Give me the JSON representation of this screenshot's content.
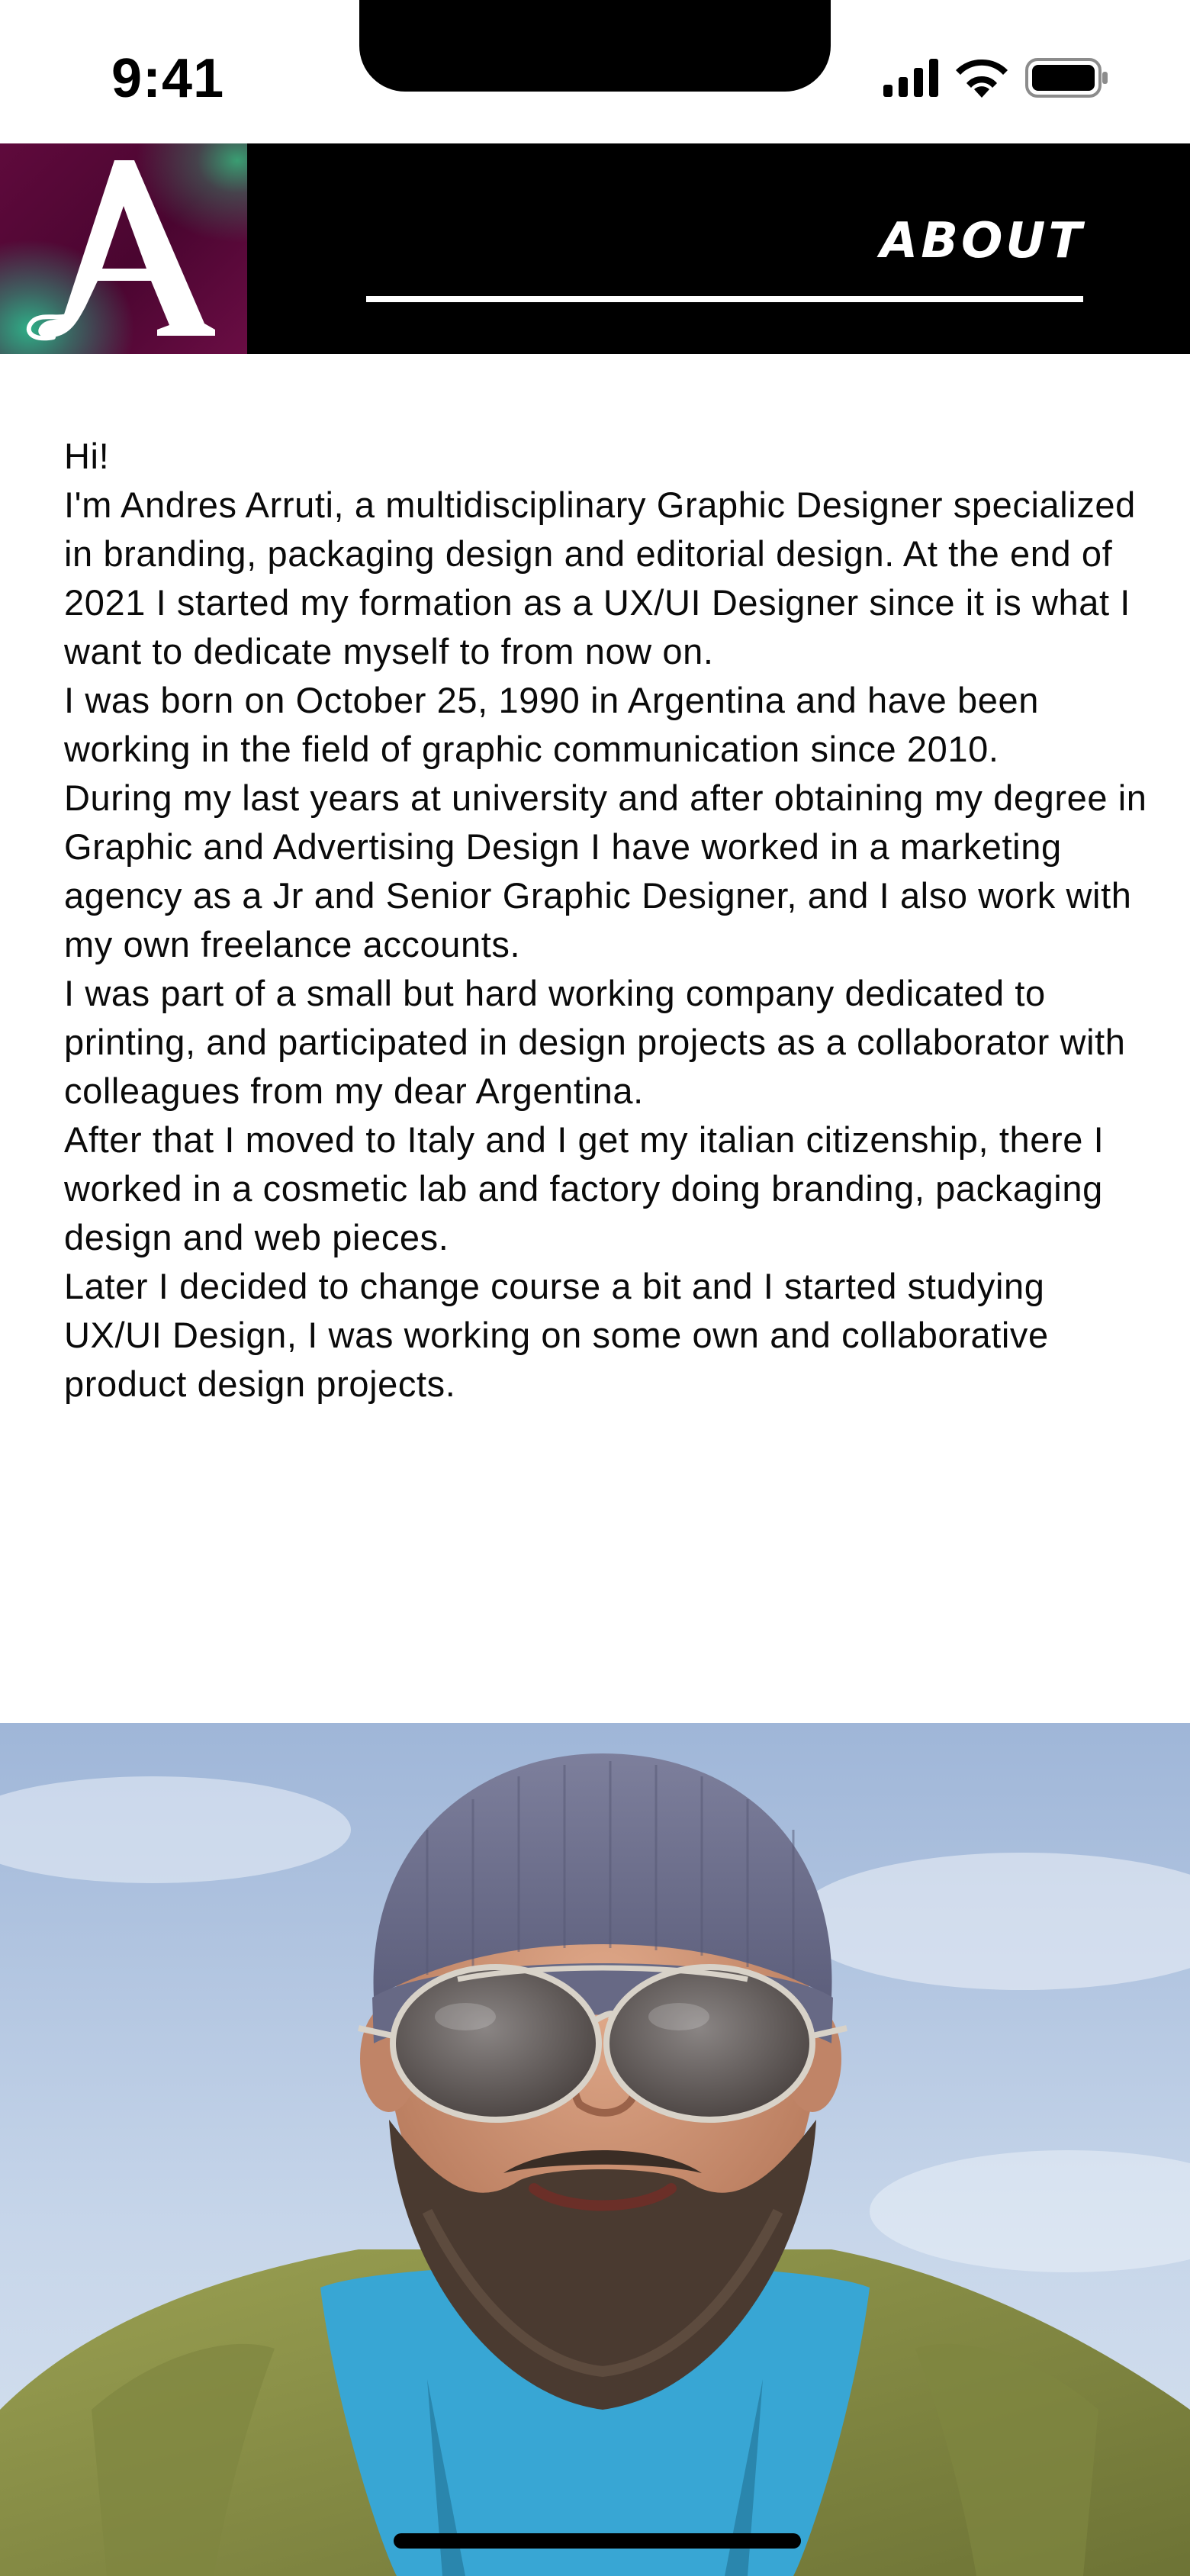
{
  "status_bar": {
    "time": "9:41",
    "icons": [
      "cellular-signal-icon",
      "wifi-icon",
      "battery-icon"
    ]
  },
  "header": {
    "logo": {
      "letter": "A",
      "icon": "brand-logo-icon",
      "background_color": "#5f0a3c",
      "accent_color": "#2fae87"
    },
    "title": "ABOUT",
    "underline_color": "#ffffff",
    "background_color": "#000000"
  },
  "bio": {
    "paragraphs": [
      "Hi!",
      "I'm Andres Arruti, a multidisciplinary Graphic Designer specialized in branding, packaging design and editorial design. At the end of 2021 I started my formation as a UX/UI Designer since it is what I want to dedicate myself to from now on.",
      "I was born on October 25, 1990 in Argentina and have been working in the field of graphic communication since 2010.",
      "During my last years at university and after obtaining my degree in Graphic and Advertising Design I have worked in a marketing agency as a Jr and Senior Graphic Designer, and I also work with my own freelance accounts.",
      "I was part of a small but hard working company dedicated to printing, and participated in design projects as a collaborator with colleagues from my dear Argentina.",
      "After that I moved to Italy and I get my italian citizenship, there I worked in a cosmetic lab and factory doing branding, packaging design and web pieces.",
      "Later I decided to change course a bit and I started studying UX/UI Design, I was working on some own and collaborative product design projects."
    ]
  },
  "photo": {
    "icon": "profile-photo"
  }
}
